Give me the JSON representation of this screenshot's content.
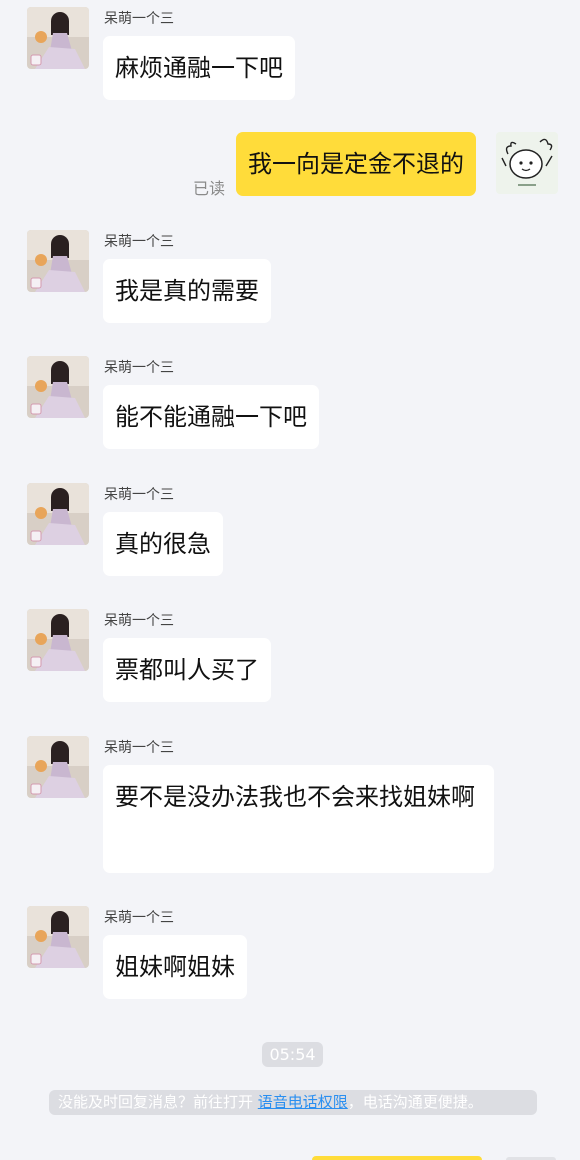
{
  "contact": {
    "name": "呆萌一个三"
  },
  "messages": [
    {
      "text": "麻烦通融一下吧"
    },
    {
      "text": "我一向是定金不退的",
      "status": "已读"
    },
    {
      "text": "我是真的需要"
    },
    {
      "text": "能不能通融一下吧"
    },
    {
      "text": "真的很急"
    },
    {
      "text": "票都叫人买了"
    },
    {
      "text": "要不是没办法我也不会来找姐妹啊"
    },
    {
      "text": "姐妹啊姐妹"
    }
  ],
  "timestamp": "05:54",
  "notice": {
    "prefix": "没能及时回复消息？前往打开 ",
    "link": "语音电话权限",
    "suffix": "，电话沟通更便捷。"
  },
  "colors": {
    "background": "#f3f4f8",
    "my_bubble": "#ffdc3a",
    "other_bubble": "#ffffff",
    "link": "#2b8ff0"
  },
  "icons": {
    "contact_avatar": "girl-photo-avatar",
    "my_avatar": "cartoon-doodle-avatar"
  }
}
